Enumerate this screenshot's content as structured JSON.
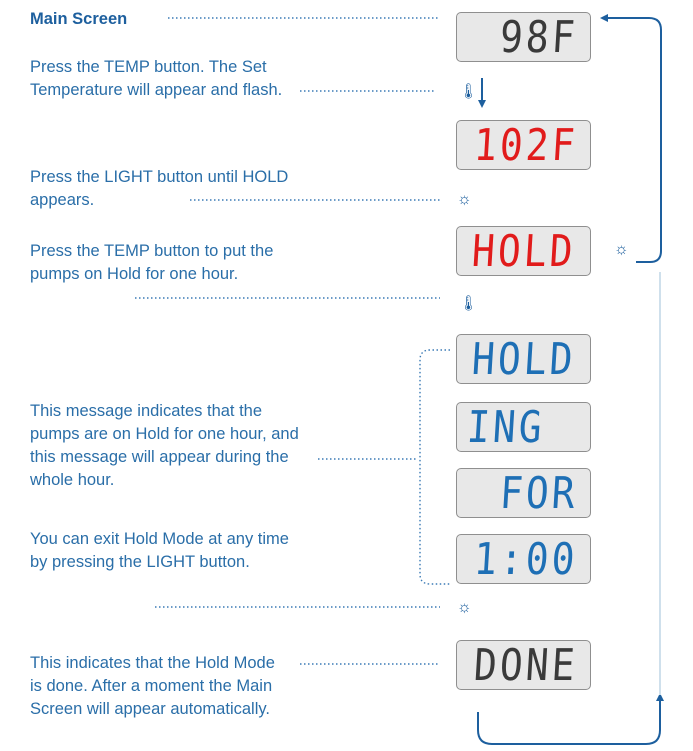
{
  "title": "Main Screen",
  "steps": {
    "temp_press": "Press the TEMP button. The Set Temperature will appear and flash.",
    "light_press": "Press the LIGHT button until HOLD appears.",
    "temp_hold": "Press the TEMP button to put the pumps on Hold for one hour.",
    "hold_message": "This message indicates that the pumps are on Hold for one hour, and this message will appear during the whole hour.",
    "exit_hold": "You can exit Hold Mode at any time by pressing the LIGHT button.",
    "done": "This indicates that the Hold Mode is done. After a moment the Main Screen will appear automatically."
  },
  "displays": {
    "main": "98F",
    "set_temp": "102F",
    "hold_red": "HOLD",
    "hold": "HOLD",
    "ing": "ING",
    "for": "FOR",
    "time": "1:00",
    "done": "DONE"
  },
  "colors": {
    "text": "#2a6ea8",
    "lcd_dark": "#3a3a3a",
    "lcd_red": "#e11b1b",
    "lcd_blue": "#1e6fb5",
    "lcd_bg": "#e8e8e8"
  },
  "icons": {
    "thermometer": "thermometer-icon",
    "light": "light-icon"
  }
}
